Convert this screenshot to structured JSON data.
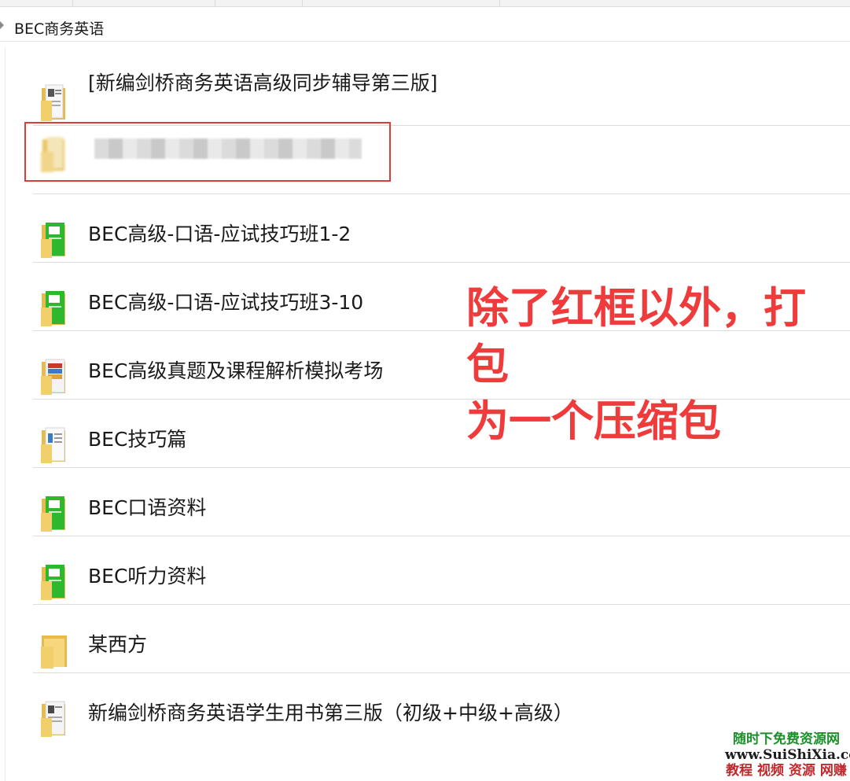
{
  "breadcrumb": {
    "current": "BEC商务英语"
  },
  "files": [
    {
      "name": "[新编剑桥商务英语高级同步辅导第三版]",
      "icon": "document-folder-icon"
    },
    {
      "name": "",
      "icon": "blurred-folder-icon"
    },
    {
      "name": "BEC高级-口语-应试技巧班1-2",
      "icon": "green-book-folder-icon"
    },
    {
      "name": "BEC高级-口语-应试技巧班3-10",
      "icon": "green-book-folder-icon"
    },
    {
      "name": "BEC高级真题及课程解析模拟考场",
      "icon": "media-folder-icon"
    },
    {
      "name": "BEC技巧篇",
      "icon": "document-folder-icon"
    },
    {
      "name": "BEC口语资料",
      "icon": "green-book-folder-icon"
    },
    {
      "name": "BEC听力资料",
      "icon": "green-book-folder-icon"
    },
    {
      "name": "某西方",
      "icon": "plain-folder-icon"
    },
    {
      "name": "新编剑桥商务英语学生用书第三版（初级+中级+高级）",
      "icon": "document-folder-icon"
    }
  ],
  "annotation": {
    "line1": "除了红框以外，打包",
    "line2": "为一个压缩包"
  },
  "watermark": {
    "line1": "随时下免费资源网",
    "line2": "www.SuiShiXia.com",
    "line3": "教程 视频 资源 网赚"
  },
  "colors": {
    "annotation": "#ef3b3b",
    "folder": "#f1cf6a",
    "highlight_box": "#e03a3a",
    "green_book": "#2eb82e"
  }
}
